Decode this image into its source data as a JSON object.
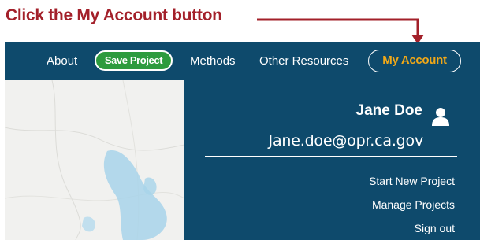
{
  "callout": {
    "text": "Click the My Account button"
  },
  "nav": {
    "about": "About",
    "save_project": "Save Project",
    "methods": "Methods",
    "other_resources": "Other Resources",
    "my_account": "My Account"
  },
  "account_panel": {
    "user_name": "Jane Doe",
    "email": "Jane.doe@opr.ca.gov",
    "links": [
      "Start New Project",
      "Manage Projects",
      "Sign out"
    ]
  },
  "icons": [
    "user-icon",
    "arrow-down-icon"
  ],
  "colors": {
    "callout": "#a3202a",
    "navbar": "#0e4a6c",
    "save_button": "#2d9b3e",
    "my_account_text": "#f0a818",
    "map_background": "#f1f1ef",
    "lake": "#a8d4ea"
  }
}
